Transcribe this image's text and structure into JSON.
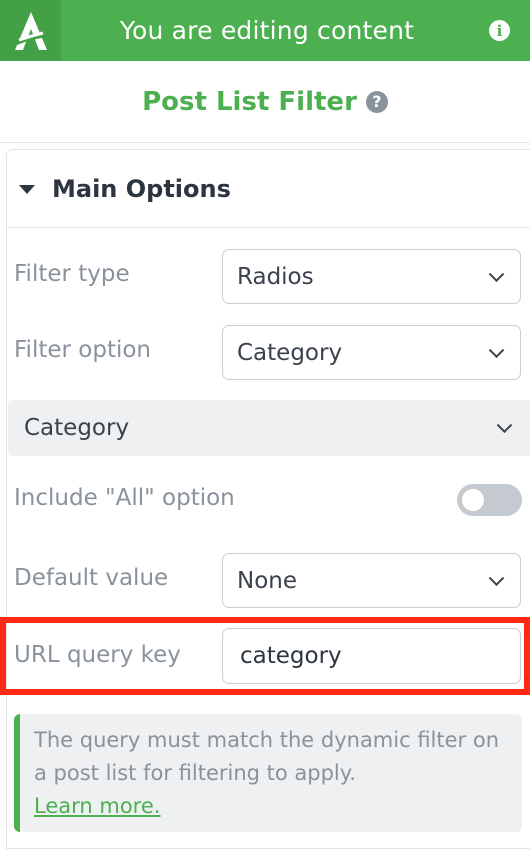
{
  "topbar": {
    "logo_letter": "A",
    "title": "You are editing content",
    "info_glyph": "i",
    "icons": [
      "app-logo-icon",
      "info-icon"
    ]
  },
  "panel": {
    "title": "Post List Filter",
    "help_glyph": "?"
  },
  "section": {
    "title": "Main Options",
    "icon": "caret-down-icon"
  },
  "fields": {
    "filter_type": {
      "label": "Filter type",
      "value": "Radios"
    },
    "filter_option": {
      "label": "Filter option",
      "value": "Category"
    },
    "category_group": {
      "label": "Category"
    },
    "include_all": {
      "label": "Include \"All\" option",
      "enabled": false
    },
    "default_value": {
      "label": "Default value",
      "value": "None"
    },
    "url_query_key": {
      "label": "URL query key",
      "value": "category"
    }
  },
  "notice": {
    "text": "The query must match the dynamic filter on a post list for filtering to apply.",
    "link": "Learn more."
  },
  "colors": {
    "brand_green": "#4caf50",
    "highlight_red": "#ff2a13",
    "muted_text": "#8a929c"
  }
}
